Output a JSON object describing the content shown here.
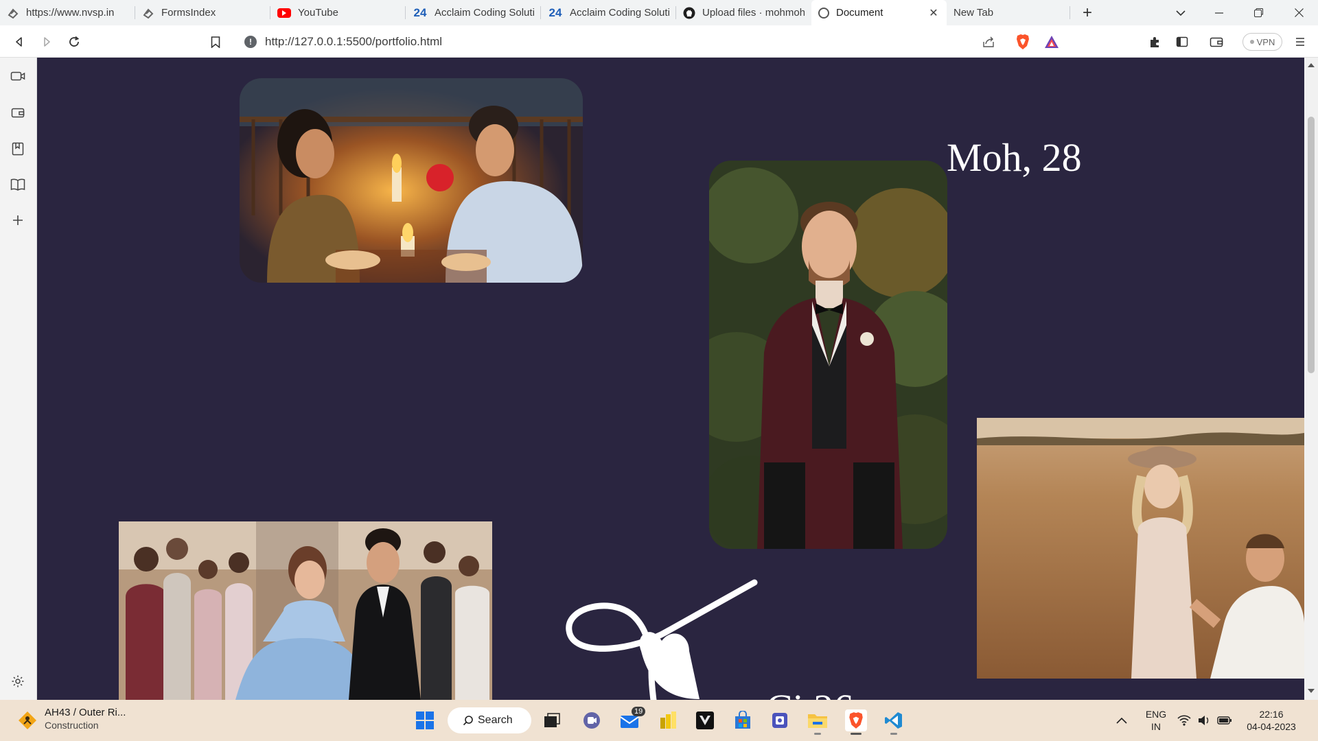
{
  "browser": {
    "tabs": [
      {
        "title": "https://www.nvsp.in",
        "icon": "nvsp-icon",
        "active": false
      },
      {
        "title": "FormsIndex",
        "icon": "nvsp-icon",
        "active": false
      },
      {
        "title": "YouTube",
        "icon": "youtube-icon",
        "active": false
      },
      {
        "title": "Acclaim Coding Solutic",
        "icon": "acclaim-24-icon",
        "active": false
      },
      {
        "title": "Acclaim Coding Solutic",
        "icon": "acclaim-24-icon",
        "active": false
      },
      {
        "title": "Upload files · mohmoh",
        "icon": "github-icon",
        "active": false
      },
      {
        "title": "Document",
        "icon": "globe-icon",
        "active": true,
        "close": "✕"
      },
      {
        "title": "New Tab",
        "icon": "",
        "active": false
      }
    ],
    "new_tab": "+",
    "address": "http://127.0.0.1:5500/portfolio.html",
    "vpn_label": "VPN"
  },
  "page": {
    "name_age": "Moh, 28",
    "partial_text": "Ci 26"
  },
  "taskbar": {
    "widget_title": "AH43 / Outer Ri...",
    "widget_subtitle": "Construction",
    "search_label": "Search",
    "mail_badge": "19",
    "lang_top": "ENG",
    "lang_bottom": "IN",
    "time": "22:16",
    "date": "04-04-2023"
  },
  "colors": {
    "page_background": "#2a2540",
    "taskbar": "#f0e2d2",
    "tab_strip": "#f1f3f4",
    "brave_orange": "#fb542b"
  }
}
